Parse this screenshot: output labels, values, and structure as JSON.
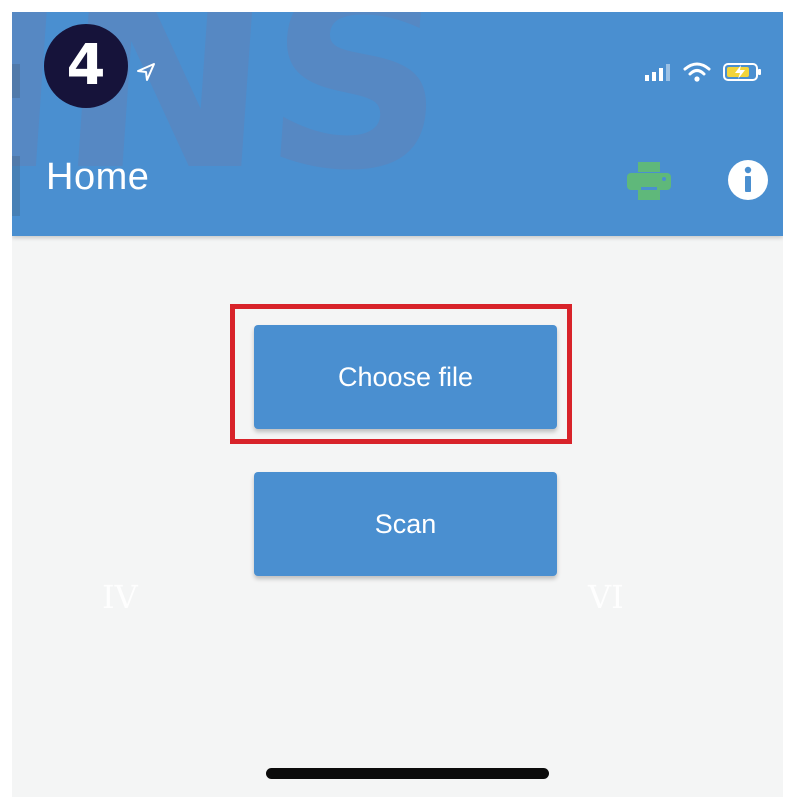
{
  "step_badge": "4",
  "watermark_text": "INS",
  "status_bar": {
    "signal_icon": "signal-bars-icon",
    "wifi_icon": "wifi-icon",
    "battery_icon": "battery-charging-icon"
  },
  "header": {
    "title": "Home",
    "print_icon": "printer-icon",
    "info_icon": "info-icon"
  },
  "main": {
    "choose_file_label": "Choose file",
    "scan_label": "Scan"
  },
  "roman_numerals": {
    "left": "IV",
    "right": "VI"
  },
  "colors": {
    "primary": "#4a8fd0",
    "background": "#f4f5f5",
    "highlight": "#d8232a",
    "print_icon": "#5fb87a",
    "badge": "#16133a"
  }
}
